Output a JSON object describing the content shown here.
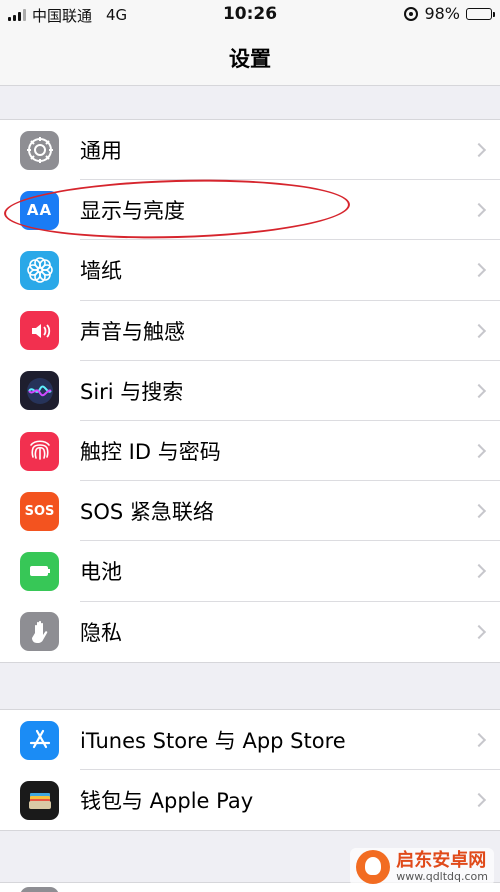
{
  "status_bar": {
    "carrier": "中国联通",
    "network": "4G",
    "time": "10:26",
    "battery": "98%",
    "battery_level": 0.98
  },
  "nav": {
    "title": "设置"
  },
  "group1": {
    "items": [
      {
        "label": "通用",
        "icon": "gear-icon"
      },
      {
        "label": "显示与亮度",
        "icon": "display-brightness-icon",
        "icon_text": "AA"
      },
      {
        "label": "墙纸",
        "icon": "wallpaper-flower-icon"
      },
      {
        "label": "声音与触感",
        "icon": "speaker-icon"
      },
      {
        "label": "Siri 与搜索",
        "icon": "siri-icon"
      },
      {
        "label": "触控 ID 与密码",
        "icon": "fingerprint-icon"
      },
      {
        "label": "SOS 紧急联络",
        "icon": "sos-icon",
        "icon_text": "SOS"
      },
      {
        "label": "电池",
        "icon": "battery-icon"
      },
      {
        "label": "隐私",
        "icon": "hand-icon"
      }
    ]
  },
  "group2": {
    "items": [
      {
        "label": "iTunes Store 与 App Store",
        "icon": "app-store-icon"
      },
      {
        "label": "钱包与 Apple Pay",
        "icon": "wallet-icon"
      }
    ]
  },
  "watermark": {
    "name": "启东安卓网",
    "url": "www.qdltdq.com"
  },
  "colors": {
    "background": "#efeff4",
    "annotation": "#d6252d",
    "chevron": "#c7c7cc"
  }
}
